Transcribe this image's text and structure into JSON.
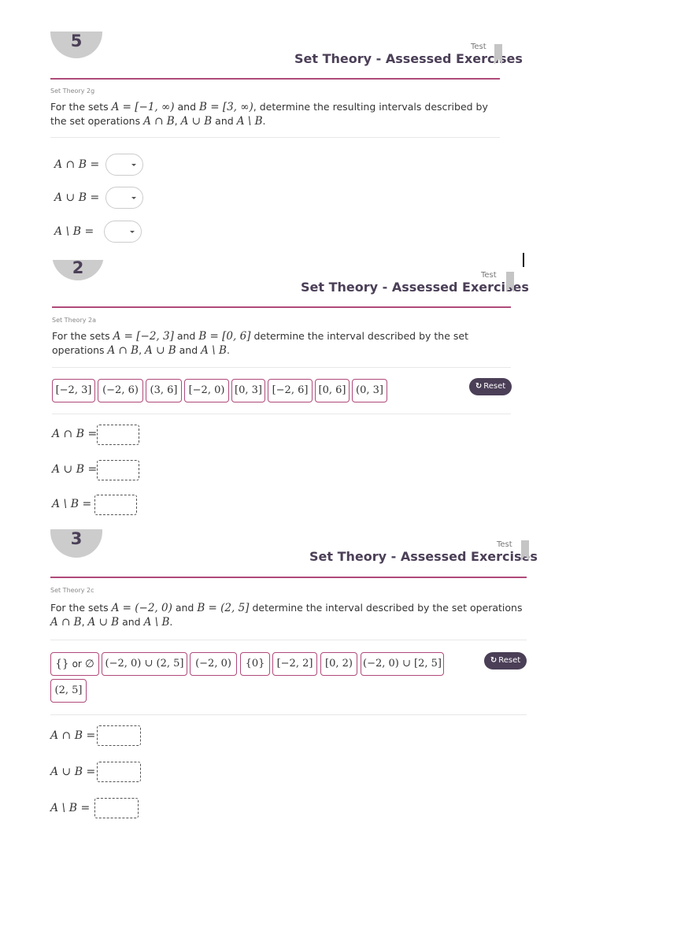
{
  "header": {
    "test_label": "Test",
    "title": "Set Theory - Assessed Exercises"
  },
  "q5": {
    "number": "5",
    "qid": "Set Theory 2g",
    "intro": "For the sets",
    "setA": "A = [−1, ∞)",
    "setB": "B = [3, ∞)",
    "mid1": "determine the resulting intervals described by the set operations",
    "op1": "A ∩ B",
    "op2": "A ∪ B",
    "op3": "A \\ B",
    "and_word": "and",
    "eq1": "A ∩ B =",
    "eq2": "A ∪ B =",
    "eq3": "A \\ B ="
  },
  "q2": {
    "number": "2",
    "qid": "Set Theory 2a",
    "intro": "For the sets",
    "setA": "A = [−2, 3]",
    "setB": "B = [0, 6]",
    "mid1": "determine the interval described by the set operations",
    "op1": "A ∩ B",
    "op2": "A ∪ B",
    "op3": "A \\ B",
    "and_word": "and",
    "tiles": [
      "[−2, 3]",
      "(−2, 6)",
      "(3, 6]",
      "[−2, 0)",
      "[0, 3]",
      "[−2, 6]",
      "[0, 6]",
      "(0, 3]"
    ],
    "reset_label": "Reset",
    "eq1": "A ∩ B =",
    "eq2": "A ∪ B =",
    "eq3": "A \\ B ="
  },
  "q3": {
    "number": "3",
    "qid": "Set Theory 2c",
    "intro": "For the sets",
    "setA": "A = (−2, 0)",
    "setB": "B = (2, 5]",
    "mid1": "determine the interval described by the set operations",
    "op1": "A ∩ B",
    "op2": "A ∪ B",
    "op3": "A \\ B",
    "and_word": "and",
    "tile0_math1": "{}",
    "tile0_or": "or",
    "tile0_math2": "∅",
    "tiles": [
      "(−2, 0) ∪ (2, 5]",
      "(−2, 0)",
      "{0}",
      "[−2, 2]",
      "[0, 2)",
      "(−2, 0) ∪ [2, 5]",
      "(2, 5]"
    ],
    "reset_label": "Reset",
    "eq1": "A ∩ B =",
    "eq2": "A ∪ B =",
    "eq3": "A \\ B ="
  },
  "icons": {
    "reset": "refresh-icon",
    "dropdown": "caret-down-icon",
    "bookmark": "bookmark-icon"
  },
  "colors": {
    "accent": "#b04a7a",
    "dark": "#4b3f57",
    "badge": "#cccccc"
  }
}
